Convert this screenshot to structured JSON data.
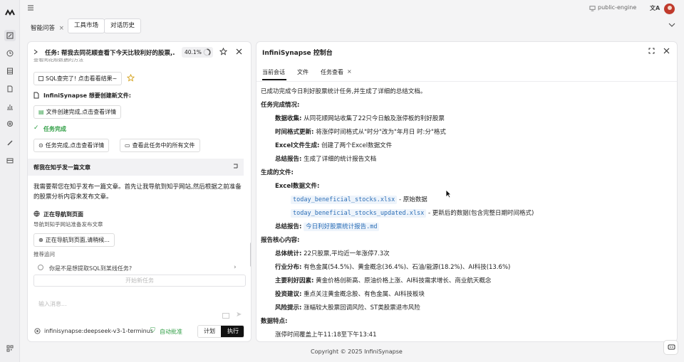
{
  "topbar": {
    "engine": "public-engine"
  },
  "tabs": [
    {
      "label": "智能问答",
      "close": "×"
    },
    {
      "label": "工具市场"
    },
    {
      "label": "对话历史"
    }
  ],
  "left": {
    "task_prefix": "任务:",
    "task_title": "帮我去同花顺查看下今天比较利好的股票,...",
    "progress": "40.1%",
    "progress_value": 0.401,
    "cut_line": "查看同花顺数据的方法",
    "sql_btn": "SQL查完了! 点击看看结果~",
    "create_notice": "InfiniSynapse 想要创建新文件:",
    "file_btn": "文件创建完成,点击查看详情",
    "task_done": "任务完成",
    "done_btn": "任务完成,点击查看详情",
    "all_files_btn": "查看此任务中的所有文件",
    "section_title": "帮我在知乎发一篇文章",
    "message": "我需要帮您在知乎发布一篇文章。首先让我导航到知乎网站,然后根据之前准备的股票分析内容来发布文章。",
    "nav_title": "正在导航到页面",
    "nav_sub": "导航到知乎网站准备发布文章",
    "nav_btn": "正在导航到页面,请稍候...",
    "suggest_label": "推荐追问",
    "suggest_item": "你是不是想提取SQL到某线任务?",
    "start_new": "开始新任务",
    "input_placeholder": "输入消息...",
    "model": "infinisynapse:deepseek-v3-1-terminus",
    "auto_approve": "自动批准",
    "plan": "计划",
    "execute": "执行"
  },
  "right": {
    "title": "InfiniSynapse 控制台",
    "tabs": [
      "当前会话",
      "文件",
      "任务查看"
    ],
    "tab_close": "×",
    "intro": "已成功完成今日利好股票统计任务,并生成了详细的总结文档。",
    "completion_heading": "任务完成情况:",
    "completion": [
      {
        "label": "数据收集:",
        "text": "从同花顺网站收集了22只今日触及涨停板的利好股票"
      },
      {
        "label": "时间格式更新:",
        "text": "将涨停时间格式从\"时分\"改为\"年月日 时:分\"格式"
      },
      {
        "label": "Excel文件生成:",
        "text": "创建了两个Excel数据文件"
      },
      {
        "label": "总结报告:",
        "text": "生成了详细的统计报告文档"
      }
    ],
    "files_heading": "生成的文件:",
    "excel_heading": "Excel数据文件:",
    "files": [
      {
        "name": "today_beneficial_stocks.xlsx",
        "desc": "- 原始数据"
      },
      {
        "name": "today_beneficial_stocks_updated.xlsx",
        "desc": "- 更新后的数据(包含完整日期时间格式)"
      }
    ],
    "report_label": "总结报告:",
    "report_file": "今日利好股票统计报告.md",
    "core_heading": "报告核心内容:",
    "core": [
      {
        "label": "总体统计:",
        "text": "22只股票,平均近一年涨停7.3次"
      },
      {
        "label": "行业分布:",
        "text": "有色金属(54.5%)、黄金概念(36.4%)、石油/能源(18.2%)、AI科技(13.6%)"
      },
      {
        "label": "主要利好因素:",
        "text": "黄金价格创新高、原油价格上涨、AI科技需求增长、商业航天概念"
      },
      {
        "label": "投资建议:",
        "text": "重点关注黄金概念股、有色金属、AI科技板块"
      },
      {
        "label": "风险提示:",
        "text": "涨幅较大股票回调风险、ST类股票退市风险"
      }
    ],
    "data_heading": "数据特点:",
    "data_line": "涨停时间覆盖上午11:18至下午13:41"
  },
  "footer": {
    "copyright": "Copyright © 2025 InfiniSynapse"
  }
}
